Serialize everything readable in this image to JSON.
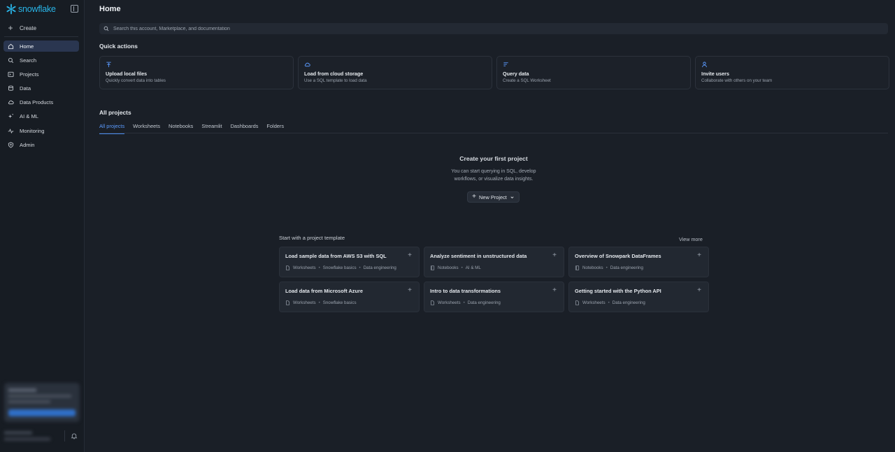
{
  "brand": {
    "name": "snowflake",
    "accent": "#29b5e8"
  },
  "sidebar": {
    "create_label": "Create",
    "items": [
      {
        "label": "Home",
        "icon": "home-icon",
        "active": true
      },
      {
        "label": "Search",
        "icon": "search-icon"
      },
      {
        "label": "Projects",
        "icon": "terminal-icon"
      },
      {
        "label": "Data",
        "icon": "database-icon"
      },
      {
        "label": "Data Products",
        "icon": "cloud-icon"
      },
      {
        "label": "AI & ML",
        "icon": "sparkle-icon"
      },
      {
        "label": "Monitoring",
        "icon": "activity-icon"
      },
      {
        "label": "Admin",
        "icon": "shield-icon"
      }
    ]
  },
  "header": {
    "title": "Home"
  },
  "search": {
    "placeholder": "Search this account, Marketplace, and documentation"
  },
  "quick_actions": {
    "heading": "Quick actions",
    "cards": [
      {
        "title": "Upload local files",
        "subtitle": "Quickly convert data into tables",
        "icon": "upload-icon"
      },
      {
        "title": "Load from cloud storage",
        "subtitle": "Use a SQL template to load data",
        "icon": "cloud-icon"
      },
      {
        "title": "Query data",
        "subtitle": "Create a SQL Worksheet",
        "icon": "query-icon"
      },
      {
        "title": "Invite users",
        "subtitle": "Collaborate with others on your team",
        "icon": "user-icon"
      }
    ]
  },
  "projects": {
    "heading": "All projects",
    "tabs": [
      "All projects",
      "Worksheets",
      "Notebooks",
      "Streamlit",
      "Dashboards",
      "Folders"
    ],
    "active_tab": "All projects",
    "empty_title": "Create your first project",
    "empty_desc_line1": "You can start querying in SQL, develop",
    "empty_desc_line2": "workflows, or visualize data insights.",
    "new_project_label": "New Project"
  },
  "templates": {
    "heading": "Start with a project template",
    "view_more": "View more",
    "items": [
      {
        "title": "Load sample data from AWS S3 with SQL",
        "type": "Worksheets",
        "tag": "Snowflake basics",
        "tag2": "Data engineering"
      },
      {
        "title": "Analyze sentiment in unstructured data",
        "type": "Notebooks",
        "tag": "AI & ML"
      },
      {
        "title": "Overview of Snowpark DataFrames",
        "type": "Notebooks",
        "tag": "Data engineering"
      },
      {
        "title": "Load data from Microsoft Azure",
        "type": "Worksheets",
        "tag": "Snowflake basics"
      },
      {
        "title": "Intro to data transformations",
        "type": "Worksheets",
        "tag": "Data engineering"
      },
      {
        "title": "Getting started with the Python API",
        "type": "Worksheets",
        "tag": "Data engineering"
      }
    ]
  }
}
